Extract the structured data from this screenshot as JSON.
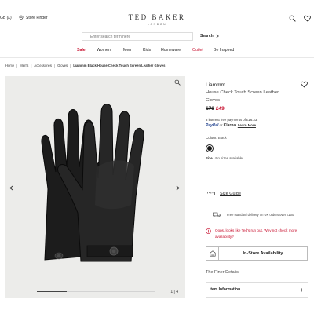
{
  "header": {
    "region": "GB (£)",
    "store_finder": "Store Finder",
    "brand": "TED BAKER",
    "city": "LONDON"
  },
  "search": {
    "placeholder": "Enter search term here",
    "button": "Search"
  },
  "nav": {
    "items": [
      "Sale",
      "Women",
      "Men",
      "Kids",
      "Homeware",
      "Outlet",
      "Be Inspired"
    ]
  },
  "breadcrumb": {
    "items": [
      "Home",
      "Men's",
      "Accessories",
      "Gloves"
    ],
    "current": "Liammm Black House Check Touch Screen Leather Gloves"
  },
  "gallery": {
    "counter": "1 | 4",
    "progress_fraction": 0.25
  },
  "product": {
    "brand": "Liammm",
    "name": "House Check Touch Screen Leather Gloves",
    "old_price": "£70",
    "new_price": "£49",
    "installments": "3 interest free payments of £16.33.",
    "paypal": "PayPal",
    "klarna": "Klarna.",
    "learn_more": "Learn More",
    "or": "or",
    "colour_label": "Colour:",
    "colour_value": "Black",
    "size_label": "Size",
    "size_value": "- No sizes available"
  },
  "info": {
    "size_guide": "Size Guide",
    "delivery": "Free standard delivery on UK orders over £100",
    "oops": "Oops, looks like Ted's run out. Why not check more availability?",
    "store_button": "In-Store Availability",
    "finer_details": "The Finer Details",
    "item_information": "Item Information"
  },
  "colors": {
    "sale_red": "#c8102e",
    "paypal_blue": "#1b3d8c"
  }
}
